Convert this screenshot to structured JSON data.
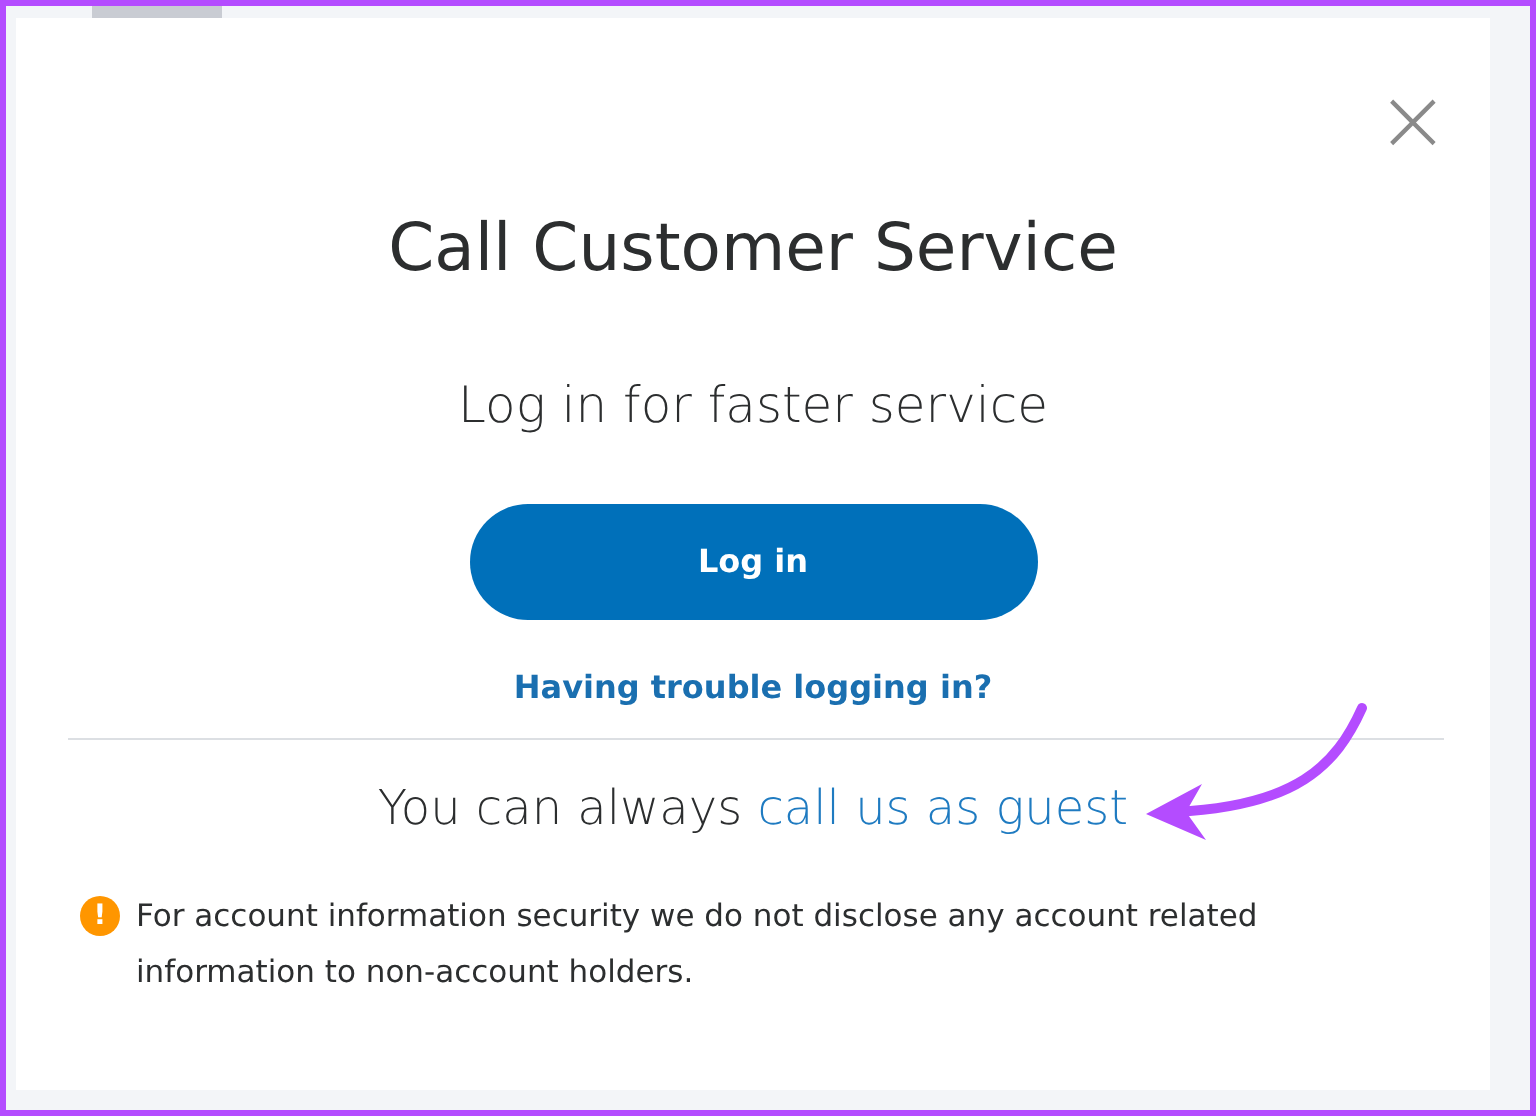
{
  "dialog": {
    "title": "Call Customer Service",
    "close": "×",
    "subtitle": "Log in for faster service",
    "login_button": "Log in",
    "trouble_link": "Having trouble logging in?",
    "guest_prefix": "You can always",
    "guest_link": "call us as guest",
    "notice": "For account information security we do not disclose any account related information to non-account holders.",
    "notice_icon": "!"
  }
}
